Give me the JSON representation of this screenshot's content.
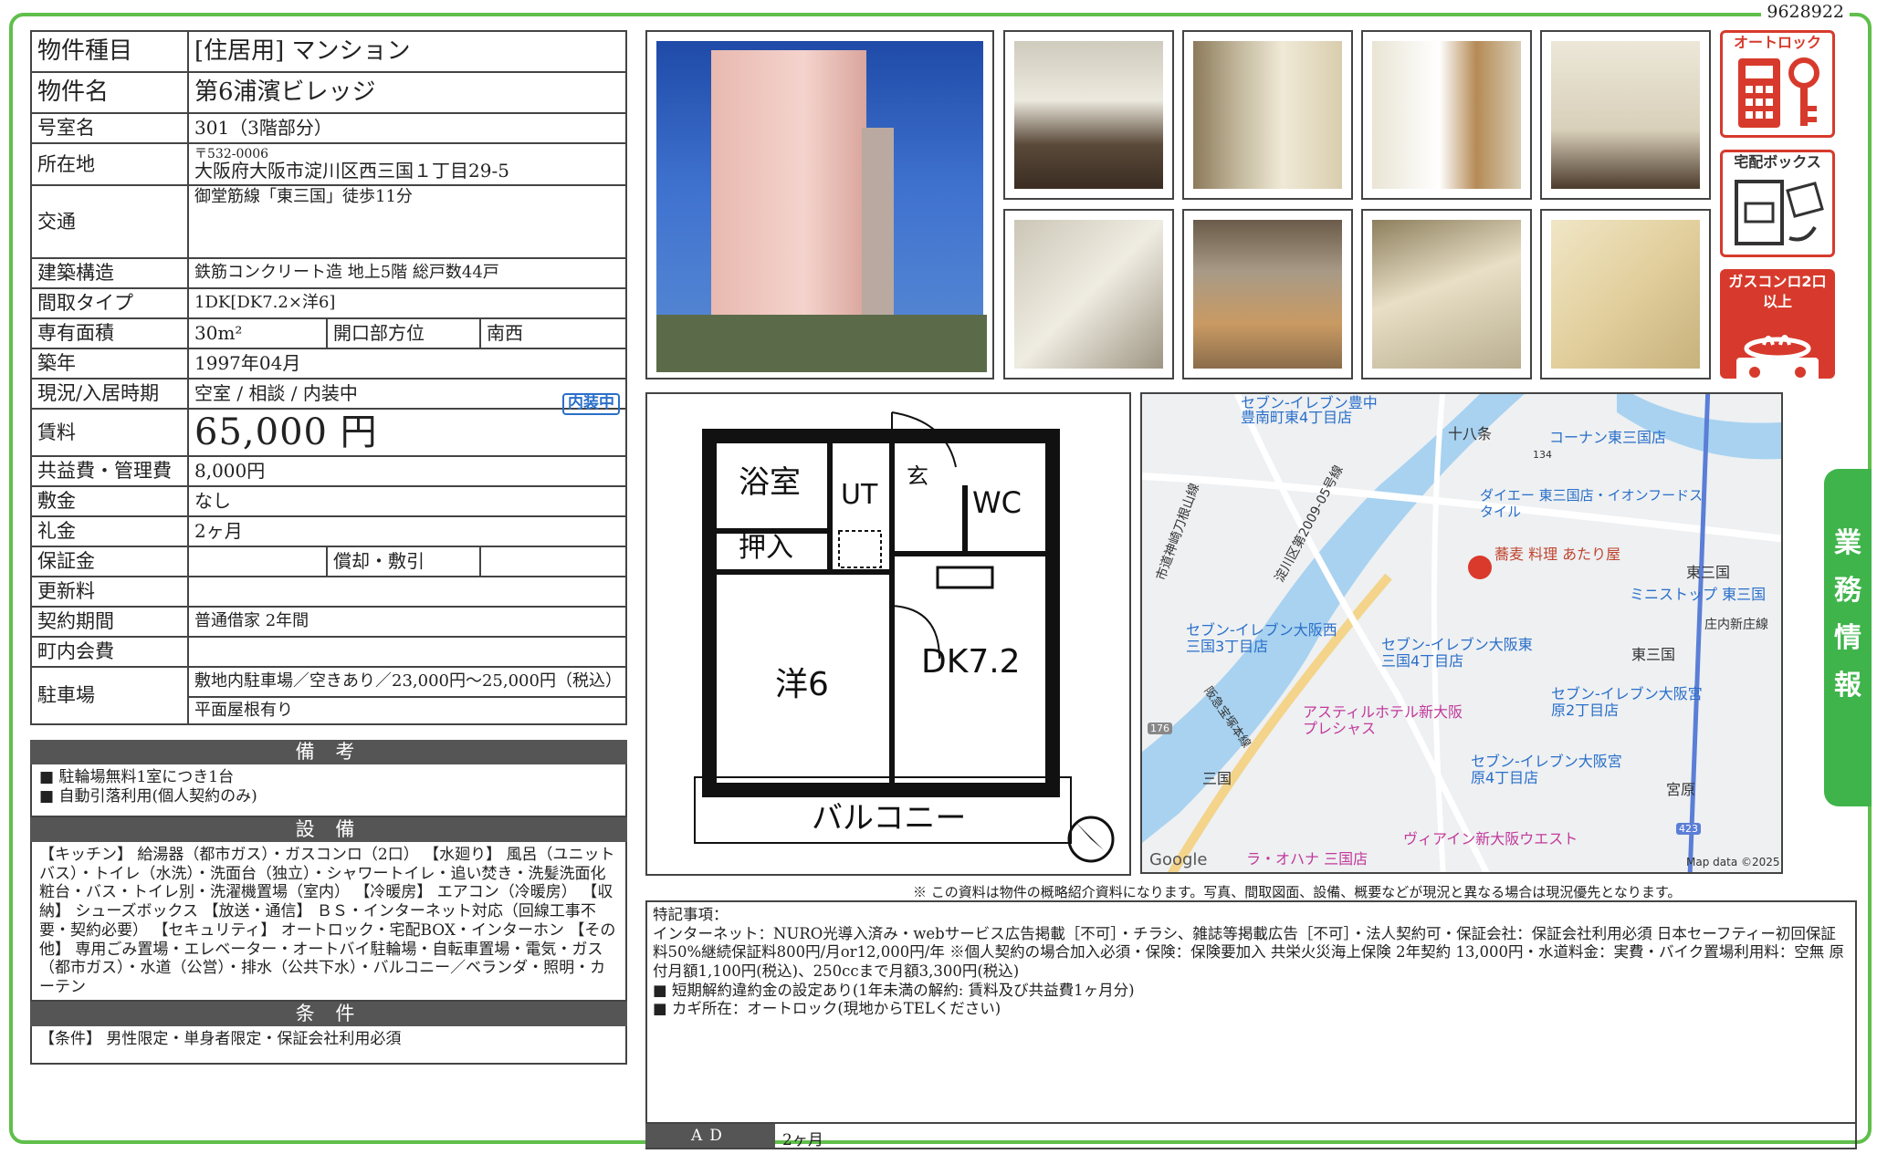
{
  "doc_id": "9628922",
  "property": {
    "type_label": "物件種目",
    "type_value": "[住居用] マンション",
    "name_label": "物件名",
    "name_value": "第6浦濱ビレッジ",
    "room_label": "号室名",
    "room_value": "301（3階部分）",
    "address_label": "所在地",
    "postal": "〒532-0006",
    "address": "大阪府大阪市淀川区西三国１丁目29-5",
    "transit_label": "交通",
    "transit_value": "御堂筋線「東三国」徒歩11分",
    "structure_label": "建築構造",
    "structure_value": "鉄筋コンクリート造 地上5階 総戸数44戸",
    "layout_label": "間取タイプ",
    "layout_value": "1DK[DK7.2×洋6]",
    "area_label": "専有面積",
    "area_value": "30m²",
    "orientation_label": "開口部方位",
    "orientation_value": "南西",
    "built_label": "築年",
    "built_value": "1997年04月",
    "status_label": "現況/入居時期",
    "status_value": "空室 / 相談 / 内装中",
    "rent_label": "賃料",
    "rent_value": "65,000 円",
    "rent_badge": "内装中",
    "fee_label": "共益費・管理費",
    "fee_value": "8,000円",
    "deposit_label": "敷金",
    "deposit_value": "なし",
    "key_money_label": "礼金",
    "key_money_value": "2ヶ月",
    "guarantee_label": "保証金",
    "amort_label": "償却・敷引",
    "renewal_label": "更新料",
    "contract_label": "契約期間",
    "contract_value": "普通借家 2年間",
    "town_fee_label": "町内会費",
    "parking_label": "駐車場",
    "parking_value1": "敷地内駐車場／空きあり／23,000円〜25,000円（税込）",
    "parking_value2": "平面屋根有り"
  },
  "remarks": {
    "title": "備 考",
    "lines": [
      "■ 駐輪場無料1室につき1台",
      "■ 自動引落利用(個人契約のみ)"
    ]
  },
  "equipment": {
    "title": "設 備",
    "text": "【キッチン】 給湯器（都市ガス）・ガスコンロ（2口） 【水廻り】 風呂（ユニットバス）・トイレ（水洗）・洗面台（独立）・シャワートイレ・追い焚き・洗髪洗面化粧台・バス・トイレ別・洗濯機置場（室内） 【冷暖房】 エアコン（冷暖房） 【収納】 シューズボックス 【放送・通信】 ＢＳ・インターネット対応（回線工事不要・契約必要） 【セキュリティ】 オートロック・宅配BOX・インターホン 【その他】 専用ごみ置場・エレベーター・オートバイ駐輪場・自転車置場・電気・ガス（都市ガス）・水道（公営）・排水（公共下水）・バルコニー／ベランダ・照明・カーテン"
  },
  "conditions": {
    "title": "条 件",
    "text": "【条件】 男性限定・単身者限定・保証会社利用必須"
  },
  "icons": {
    "autolock": "オートロック",
    "delivery_box": "宅配ボックス",
    "gas_stove": "ガスコンロ2口以上"
  },
  "floorplan": {
    "bath": "浴室",
    "ut": "UT",
    "entrance": "玄",
    "wc": "WC",
    "closet": "押入",
    "western": "洋6",
    "dk": "DK7.2",
    "balcony": "バルコニー"
  },
  "map": {
    "labels": [
      "セブン-イレブン豊中",
      "豊南町東4丁目店",
      "十八条",
      "コーナン東三国店",
      "134",
      "ダイエー 東三国店・イオンフードスタイル",
      "蕎麦 料理 あたり屋",
      "東三国",
      "ミニストップ 東三国",
      "庄内新庄線",
      "市道神崎刀根山線",
      "淀川区第2009-05号線",
      "セブン-イレブン大阪西三国3丁目店",
      "セブン-イレブン大阪東三国4丁目店",
      "東三国",
      "セブン-イレブン大阪宮原2丁目店",
      "アスティルホテル新大阪 プレシャス",
      "阪急宝塚本線",
      "176",
      "三国",
      "セブン-イレブン大阪宮原4丁目店",
      "宮原",
      "ヴィアイン新大阪ウエスト",
      "423",
      "ラ・オハナ 三国店",
      "Google",
      "Map data ©2025"
    ]
  },
  "side_tab": "業務情報",
  "note": "※ この資料は物件の概略紹介資料になります。写真、間取図面、設備、概要などが現況と異なる場合は現況優先となります。",
  "special": {
    "title": "特記事項：",
    "lines": [
      "インターネット：NURO光導入済み・webサービス広告掲載［不可］・チラシ、雑誌等掲載広告［不可］・法人契約可・保証会社：保証会社利用必須 日本セーフティー初回保証料50%継続保証料800円/月or12,000円/年 ※個人契約の場合加入必須・保険：保険要加入 共栄火災海上保険 2年契約 13,000円・水道料金：実費・バイク置場利用料：空無 原付月額1,100円(税込)、250ccまで月額3,300円(税込)",
      "■ 短期解約違約金の設定あり(1年未満の解約: 賃料及び共益費1ヶ月分)",
      "■ カギ所在：オートロック(現地からTELください)"
    ]
  },
  "ad": {
    "label": "AD",
    "value": "2ヶ月"
  }
}
